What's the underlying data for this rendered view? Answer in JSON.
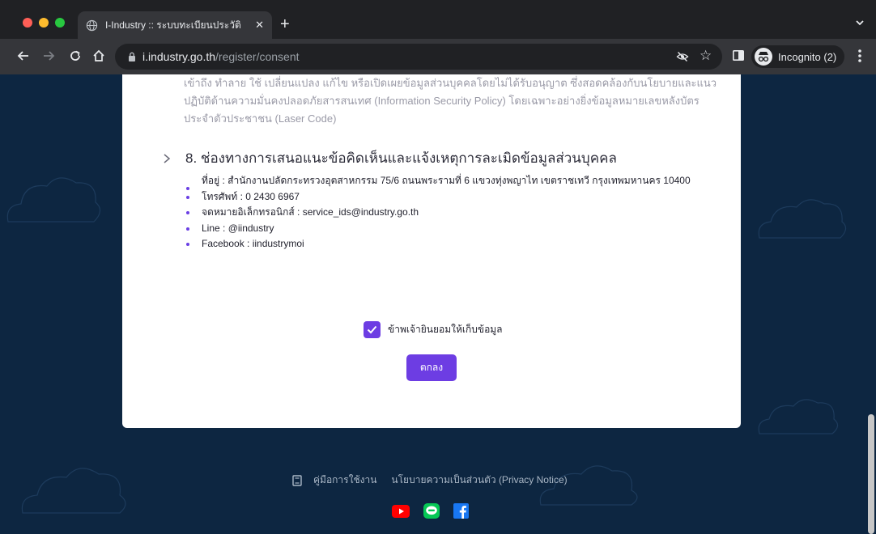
{
  "browser": {
    "tab_title": "I-Industry :: ระบบทะเบียนประวัติ",
    "tab_close": "✕",
    "new_tab": "+",
    "url_host": "i.industry.go.th",
    "url_path": "/register/consent",
    "star": "☆",
    "incognito_label": "Incognito (2)"
  },
  "page": {
    "faded_paragraph": "เข้าถึง ทำลาย ใช้ เปลี่ยนแปลง แก้ไข หรือเปิดเผยข้อมูลส่วนบุคคลโดยไม่ได้รับอนุญาต ซึ่งสอดคล้องกับนโยบายและแนวปฏิบัติด้านความมั่นคงปลอดภัยสารสนเทศ (Information Security Policy) โดยเฉพาะอย่างยิ่งข้อมูลหมายเลขหลังบัตรประจำตัวประชาชน (Laser Code)",
    "section_title": "8. ช่องทางการเสนอแนะข้อคิดเห็นและแจ้งเหตุการละเมิดข้อมูลส่วนบุคคล",
    "contacts": [
      "ที่อยู่ : สำนักงานปลัดกระทรวงอุตสาหกรรม 75/6 ถนนพระรามที่ 6 แขวงทุ่งพญาไท เขตราชเทวี กรุงเทพมหานคร 10400",
      "โทรศัพท์ : 0 2430 6967",
      "จดหมายอิเล็กทรอนิกส์ : service_ids@industry.go.th",
      "Line : @iindustry",
      "Facebook : iindustrymoi"
    ],
    "consent_label": "ข้าพเจ้ายินยอมให้เก็บข้อมูล",
    "consent_checked": true,
    "ok_button": "ตกลง"
  },
  "footer": {
    "manual_link": "คู่มือการใช้งาน",
    "privacy_link": "นโยบายความเป็นส่วนตัว (Privacy Notice)",
    "socials": [
      "youtube-icon",
      "line-icon",
      "facebook-icon"
    ]
  },
  "colors": {
    "accent": "#6d3de3",
    "page_background": "#0d2641",
    "card": "#ffffff"
  }
}
